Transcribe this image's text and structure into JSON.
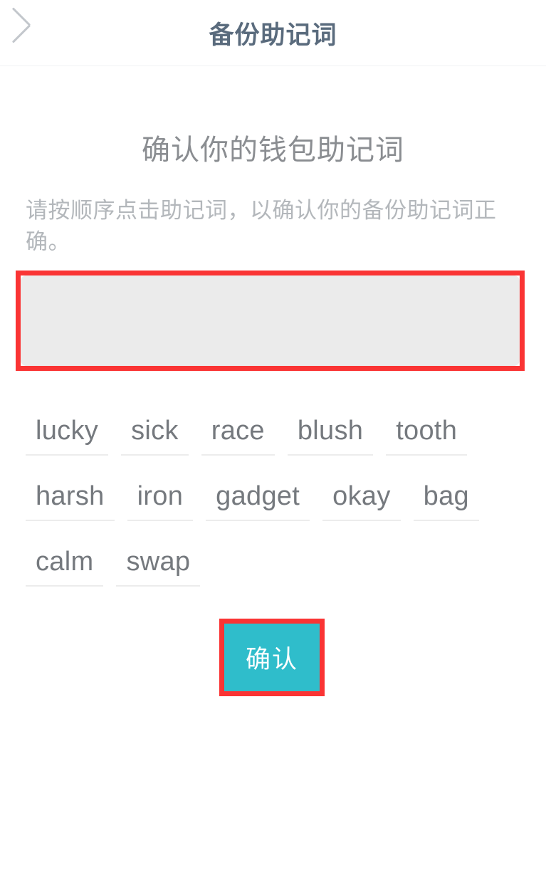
{
  "navbar": {
    "back_icon": "chevron-left-icon",
    "title": "备份助记词"
  },
  "content": {
    "heading": "确认你的钱包助记词",
    "description": "请按顺序点击助记词，以确认你的备份助记词正确。"
  },
  "answer_area": {
    "selected_words": [],
    "highlight_color": "#fa3434",
    "background_color": "#ebebeb"
  },
  "word_bank": {
    "words": [
      "lucky",
      "sick",
      "race",
      "blush",
      "tooth",
      "harsh",
      "iron",
      "gadget",
      "okay",
      "bag",
      "calm",
      "swap"
    ]
  },
  "confirm": {
    "label": "确认",
    "background_color": "#2fbdcb",
    "highlight_color": "#fa3434"
  }
}
